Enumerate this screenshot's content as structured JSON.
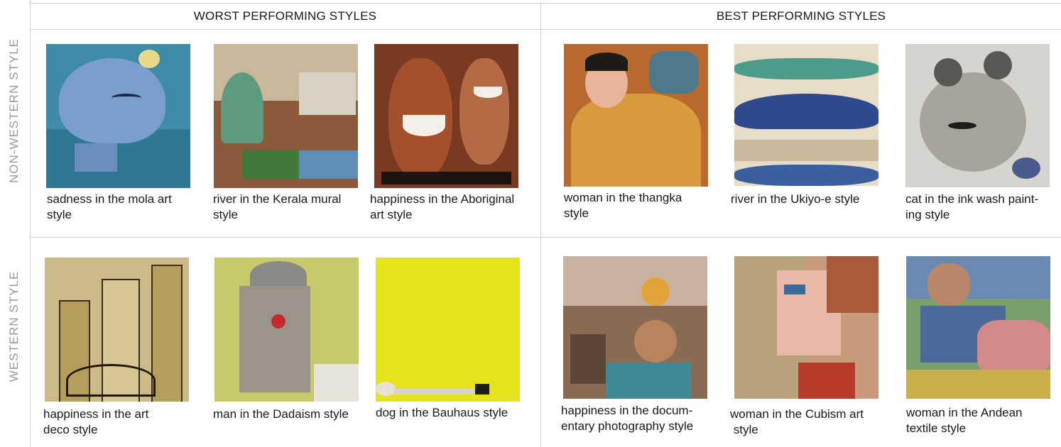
{
  "headers": {
    "worst": "WORST PERFORMING STYLES",
    "best": "BEST PERFORMING STYLES"
  },
  "row_labels": {
    "top": "NON-WESTERN STYLE",
    "bottom": "WESTERN STYLE"
  },
  "captions": {
    "nw_worst_1": [
      "sadness in the mola art",
      "style"
    ],
    "nw_worst_2": [
      "river in the Kerala mural",
      "style"
    ],
    "nw_worst_3": [
      "happiness in the Aboriginal",
      "art style"
    ],
    "nw_best_1": [
      "woman in the thangka",
      "style"
    ],
    "nw_best_2": [
      "river in the Ukiyo-e style",
      ""
    ],
    "nw_best_3": [
      "cat in the ink wash paint-",
      "ing style"
    ],
    "w_worst_1": [
      "happiness in the art",
      "deco style"
    ],
    "w_worst_2": [
      "man in the Dadaism style",
      ""
    ],
    "w_worst_3": [
      "dog in the Bauhaus style",
      ""
    ],
    "w_best_1": [
      "happiness in the docum-",
      "entary photography style"
    ],
    "w_best_2": [
      "woman in the Cubism art",
      " style"
    ],
    "w_best_3": [
      "woman in the Andean",
      "textile style"
    ]
  }
}
